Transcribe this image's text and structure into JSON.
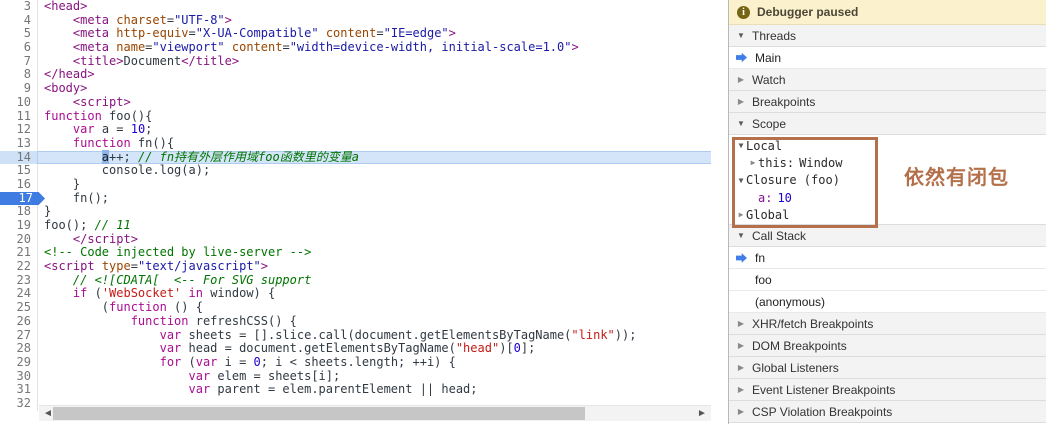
{
  "code": {
    "lines": [
      {
        "n": 3,
        "seg": [
          [
            "t",
            "<head>"
          ]
        ]
      },
      {
        "n": 4,
        "seg": [
          [
            "p",
            "    "
          ],
          [
            "t",
            "<meta"
          ],
          [
            "p",
            " "
          ],
          [
            "a",
            "charset"
          ],
          [
            "p",
            "="
          ],
          [
            "v",
            "\"UTF-8\""
          ],
          [
            "t",
            ">"
          ]
        ]
      },
      {
        "n": 5,
        "seg": [
          [
            "p",
            "    "
          ],
          [
            "t",
            "<meta"
          ],
          [
            "p",
            " "
          ],
          [
            "a",
            "http-equiv"
          ],
          [
            "p",
            "="
          ],
          [
            "v",
            "\"X-UA-Compatible\""
          ],
          [
            "p",
            " "
          ],
          [
            "a",
            "content"
          ],
          [
            "p",
            "="
          ],
          [
            "v",
            "\"IE=edge\""
          ],
          [
            "t",
            ">"
          ]
        ]
      },
      {
        "n": 6,
        "seg": [
          [
            "p",
            "    "
          ],
          [
            "t",
            "<meta"
          ],
          [
            "p",
            " "
          ],
          [
            "a",
            "name"
          ],
          [
            "p",
            "="
          ],
          [
            "v",
            "\"viewport\""
          ],
          [
            "p",
            " "
          ],
          [
            "a",
            "content"
          ],
          [
            "p",
            "="
          ],
          [
            "v",
            "\"width=device-width, initial-scale=1.0\""
          ],
          [
            "t",
            ">"
          ]
        ]
      },
      {
        "n": 7,
        "seg": [
          [
            "p",
            "    "
          ],
          [
            "t",
            "<title>"
          ],
          [
            "p",
            "Document"
          ],
          [
            "t",
            "</title>"
          ]
        ]
      },
      {
        "n": 8,
        "seg": [
          [
            "t",
            "</head>"
          ]
        ]
      },
      {
        "n": 9,
        "seg": [
          [
            "t",
            "<body>"
          ]
        ]
      },
      {
        "n": 10,
        "seg": [
          [
            "p",
            "    "
          ],
          [
            "t",
            "<script>"
          ]
        ]
      },
      {
        "n": 11,
        "seg": [
          [
            "k",
            "function"
          ],
          [
            "p",
            " foo(){"
          ]
        ]
      },
      {
        "n": 12,
        "seg": [
          [
            "p",
            "    "
          ],
          [
            "k",
            "var"
          ],
          [
            "p",
            " a = "
          ],
          [
            "n2",
            "10"
          ],
          [
            "p",
            ";"
          ]
        ]
      },
      {
        "n": 13,
        "seg": [
          [
            "p",
            "    "
          ],
          [
            "k",
            "function"
          ],
          [
            "p",
            " fn(){"
          ]
        ]
      },
      {
        "n": 14,
        "hl": true,
        "seg": [
          [
            "p",
            "        "
          ],
          [
            "sel",
            "a"
          ],
          [
            "p",
            "++; "
          ],
          [
            "c",
            "// fn持有外层作用域foo函数里的变量a"
          ]
        ]
      },
      {
        "n": 15,
        "seg": [
          [
            "p",
            "        console.log(a);"
          ]
        ]
      },
      {
        "n": 16,
        "seg": [
          [
            "p",
            "    }"
          ]
        ]
      },
      {
        "n": 17,
        "bp": true,
        "seg": [
          [
            "p",
            "    fn();"
          ]
        ]
      },
      {
        "n": 18,
        "seg": [
          [
            "p",
            "}"
          ]
        ]
      },
      {
        "n": 19,
        "seg": [
          [
            "p",
            "foo(); "
          ],
          [
            "c",
            "// 11"
          ]
        ]
      },
      {
        "n": 20,
        "seg": [
          [
            "p",
            "    "
          ],
          [
            "t",
            "</script>"
          ]
        ]
      },
      {
        "n": 21,
        "seg": [
          [
            "c2",
            "<!-- Code injected by live-server -->"
          ]
        ]
      },
      {
        "n": 22,
        "seg": [
          [
            "t",
            "<script"
          ],
          [
            "p",
            " "
          ],
          [
            "a",
            "type"
          ],
          [
            "p",
            "="
          ],
          [
            "v",
            "\"text/javascript\""
          ],
          [
            "t",
            ">"
          ]
        ]
      },
      {
        "n": 23,
        "seg": [
          [
            "p",
            "    "
          ],
          [
            "c",
            "// <![CDATA[  <-- For SVG support"
          ]
        ]
      },
      {
        "n": 24,
        "seg": [
          [
            "p",
            "    "
          ],
          [
            "k",
            "if"
          ],
          [
            "p",
            " ("
          ],
          [
            "r",
            "'WebSocket'"
          ],
          [
            "p",
            " "
          ],
          [
            "k",
            "in"
          ],
          [
            "p",
            " window) {"
          ]
        ]
      },
      {
        "n": 25,
        "seg": [
          [
            "p",
            "        ("
          ],
          [
            "k",
            "function"
          ],
          [
            "p",
            " () {"
          ]
        ]
      },
      {
        "n": 26,
        "seg": [
          [
            "p",
            "            "
          ],
          [
            "k",
            "function"
          ],
          [
            "p",
            " refreshCSS() {"
          ]
        ]
      },
      {
        "n": 27,
        "seg": [
          [
            "p",
            "                "
          ],
          [
            "k",
            "var"
          ],
          [
            "p",
            " sheets = [].slice.call(document.getElementsByTagName("
          ],
          [
            "r",
            "\"link\""
          ],
          [
            "p",
            "));"
          ]
        ]
      },
      {
        "n": 28,
        "seg": [
          [
            "p",
            "                "
          ],
          [
            "k",
            "var"
          ],
          [
            "p",
            " head = document.getElementsByTagName("
          ],
          [
            "r",
            "\"head\""
          ],
          [
            "p",
            ")["
          ],
          [
            "n2",
            "0"
          ],
          [
            "p",
            "];"
          ]
        ]
      },
      {
        "n": 29,
        "seg": [
          [
            "p",
            "                "
          ],
          [
            "k",
            "for"
          ],
          [
            "p",
            " ("
          ],
          [
            "k",
            "var"
          ],
          [
            "p",
            " i = "
          ],
          [
            "n2",
            "0"
          ],
          [
            "p",
            "; i < sheets.length; ++i) {"
          ]
        ]
      },
      {
        "n": 30,
        "seg": [
          [
            "p",
            "                    "
          ],
          [
            "k",
            "var"
          ],
          [
            "p",
            " elem = sheets[i];"
          ]
        ]
      },
      {
        "n": 31,
        "seg": [
          [
            "p",
            "                    "
          ],
          [
            "k",
            "var"
          ],
          [
            "p",
            " parent = elem.parentElement || head;"
          ]
        ]
      },
      {
        "n": 32,
        "seg": []
      }
    ]
  },
  "sidebar": {
    "banner": {
      "label": "Debugger paused",
      "icon": "info-icon",
      "bg": "#fbf2cd"
    },
    "threads": {
      "label": "Threads",
      "items": [
        {
          "label": "Main",
          "active": true
        }
      ]
    },
    "watch": {
      "label": "Watch"
    },
    "breakpoints": {
      "label": "Breakpoints"
    },
    "scope": {
      "label": "Scope",
      "tree": [
        {
          "label": "Local",
          "state": "expanded"
        },
        {
          "name": "this:",
          "value": "Window",
          "state": "collapsed"
        },
        {
          "label": "Closure (foo)",
          "state": "expanded"
        },
        {
          "name": "a:",
          "value": "10",
          "state": "leaf"
        },
        {
          "label": "Global",
          "state": "collapsed"
        }
      ]
    },
    "call_stack": {
      "label": "Call Stack",
      "frames": [
        "fn",
        "foo",
        "(anonymous)"
      ],
      "active_index": 0
    },
    "collapsed_sections": [
      "XHR/fetch Breakpoints",
      "DOM Breakpoints",
      "Global Listeners",
      "Event Listener Breakpoints",
      "CSP Violation Breakpoints"
    ]
  },
  "annotation": {
    "label": "依然有闭包",
    "color": "#b3704a"
  },
  "colors": {
    "accent_blue": "#3f7ee8",
    "breakpoint_blue": "#3e7ce2",
    "paused_line_bg": "#d4e5f9",
    "banner_bg": "#fbf2cd",
    "annotation_brown": "#b3704a",
    "keyword": "#aa0d91",
    "string": "#c41a16",
    "number": "#1c00cf",
    "comment": "#007400",
    "html_tag": "#881280",
    "html_attr": "#994500",
    "html_value": "#1a1aa6"
  }
}
